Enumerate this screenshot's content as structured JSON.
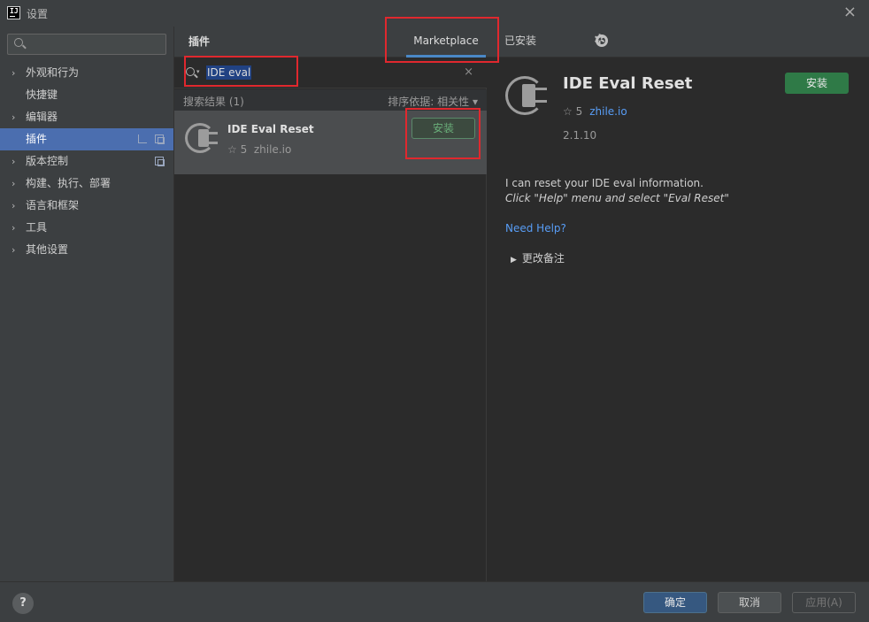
{
  "window": {
    "title": "设置",
    "close_icon": "×"
  },
  "sidebar": {
    "search_placeholder": "",
    "items": [
      {
        "label": "外观和行为",
        "expandable": true
      },
      {
        "label": "快捷键",
        "expandable": false
      },
      {
        "label": "编辑器",
        "expandable": true
      },
      {
        "label": "插件",
        "expandable": false,
        "selected": true
      },
      {
        "label": "版本控制",
        "expandable": true
      },
      {
        "label": "构建、执行、部署",
        "expandable": true
      },
      {
        "label": "语言和框架",
        "expandable": true
      },
      {
        "label": "工具",
        "expandable": true
      },
      {
        "label": "其他设置",
        "expandable": true
      }
    ],
    "chevron": "›"
  },
  "plugins": {
    "title": "插件",
    "tabs": {
      "marketplace": "Marketplace",
      "installed": "已安装"
    },
    "search": {
      "value": "IDE eval",
      "clear": "×"
    },
    "results_count": "搜索结果 (1)",
    "sort_by": "排序依据: 相关性 ▾",
    "result": {
      "name": "IDE Eval Reset",
      "rating": "☆ 5",
      "vendor": "zhile.io",
      "install_label": "安装"
    }
  },
  "detail": {
    "name": "IDE Eval Reset",
    "rating": "☆ 5",
    "vendor": "zhile.io",
    "version": "2.1.10",
    "install_label": "安装",
    "description_line1": "I can reset your IDE eval information.",
    "description_line2": "Click \"Help\" menu and select \"Eval Reset\"",
    "help_link": "Need Help?",
    "changelog_label": "更改备注",
    "changelog_arrow": "▶"
  },
  "footer": {
    "help": "?",
    "ok": "确定",
    "cancel": "取消",
    "apply": "应用(A)"
  },
  "colors": {
    "accent_blue": "#4b6eaf",
    "install_green": "#2f7a47",
    "annotation_red": "#e0282e",
    "link_blue": "#589df6"
  }
}
